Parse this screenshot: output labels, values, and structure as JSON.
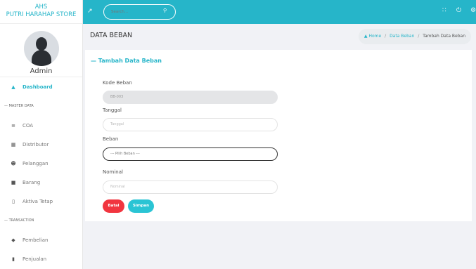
{
  "brand": {
    "line1": "AHS",
    "line2": "PUTRI HARAHAP STORE"
  },
  "profile": {
    "name": "Admin"
  },
  "sidebar": {
    "dashboard": {
      "label": "Dashboard",
      "icon": "home-icon"
    },
    "master_header": "— MASTER DATA",
    "master_items": [
      {
        "label": "COA",
        "icon": "list-icon"
      },
      {
        "label": "Distributor",
        "icon": "building-icon"
      },
      {
        "label": "Pelanggan",
        "icon": "users-icon"
      },
      {
        "label": "Barang",
        "icon": "box-icon"
      },
      {
        "label": "Aktiva Tetap",
        "icon": "file-icon"
      }
    ],
    "transaction_header": "— TRANSACTION",
    "transaction_items": [
      {
        "label": "Pembelian",
        "icon": "cart-icon"
      },
      {
        "label": "Penjualan",
        "icon": "receipt-icon"
      }
    ]
  },
  "topbar": {
    "search_placeholder": "Search..."
  },
  "page": {
    "title": "DATA BEBAN",
    "breadcrumb": {
      "home": "Home",
      "data": "Data Beban",
      "current": "Tambah Data Beban"
    }
  },
  "form": {
    "title": "— Tambah Data Beban",
    "kode_label": "Kode Beban",
    "kode_value": "BB-003",
    "tanggal_label": "Tanggal",
    "tanggal_placeholder": "Tanggal",
    "beban_label": "Beban",
    "beban_selected": "--- Pilih Beban ---",
    "nominal_label": "Nominal",
    "nominal_placeholder": "Nominal",
    "batal_label": "Batal",
    "simpan_label": "Simpan"
  },
  "colors": {
    "accent": "#26b5c9",
    "danger": "#f1353f",
    "teal_button": "#2ac4d4"
  }
}
